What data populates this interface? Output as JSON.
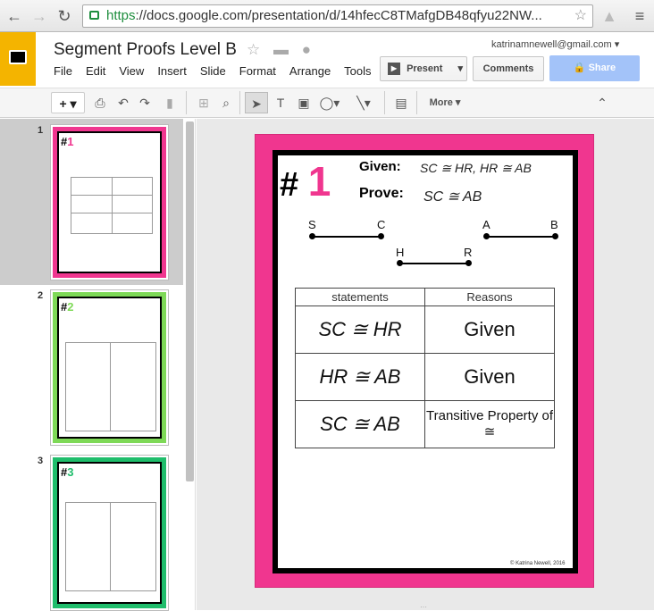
{
  "browser": {
    "url_https": "https",
    "url_rest": "://docs.google.com/presentation/d/14hfecC8TMafgDB48qfyu22NW..."
  },
  "app": {
    "title": "Segment Proofs Level B",
    "email": "katrinamnewell@gmail.com",
    "menu": [
      "File",
      "Edit",
      "View",
      "Insert",
      "Slide",
      "Format",
      "Arrange",
      "Tools"
    ],
    "present_label": "Present",
    "comments_label": "Comments",
    "share_label": "Share",
    "more_label": "More"
  },
  "filmstrip": {
    "numbers": [
      "1",
      "2",
      "3"
    ]
  },
  "slide": {
    "hash": "#",
    "number": "1",
    "given_label": "Given:",
    "given_text": "SC ≅ HR, HR ≅ AB",
    "prove_label": "Prove:",
    "prove_text": "SC ≅ AB",
    "points": [
      "S",
      "C",
      "A",
      "B",
      "H",
      "R"
    ],
    "col_statements": "statements",
    "col_reasons": "Reasons",
    "rows": [
      {
        "statement": "SC ≅ HR",
        "reason": "Given"
      },
      {
        "statement": "HR ≅ AB",
        "reason": "Given"
      },
      {
        "statement": "SC ≅ AB",
        "reason": "Transitive Property of ≅"
      }
    ],
    "copyright": "© Katrina Newell, 2016"
  },
  "colors": {
    "slide1_border": "#f0368f",
    "slide2_border": "#7ed957",
    "slide3_border": "#1fbd6b"
  }
}
